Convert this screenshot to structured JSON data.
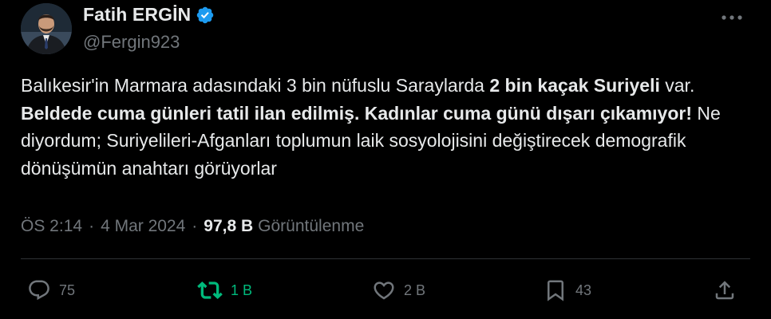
{
  "author": {
    "display_name": "Fatih ERGİN",
    "handle": "@Fergin923"
  },
  "tweet": {
    "segments": [
      {
        "text": "Balıkesir'in Marmara adasındaki 3 bin nüfuslu Saraylarda ",
        "bold": false
      },
      {
        "text": "2 bin kaçak Suriyeli",
        "bold": true
      },
      {
        "text": " var. ",
        "bold": false
      },
      {
        "text": "Beldede cuma günleri tatil ilan edilmiş. Kadınlar cuma günü dışarı çıkamıyor!",
        "bold": true
      },
      {
        "text": " Ne diyordum; Suriyelileri-Afganları toplumun laik sosyolojisini değiştirecek demografik dönüşümün anahtarı görüyorlar",
        "bold": false
      }
    ]
  },
  "meta": {
    "time": "ÖS 2:14",
    "separator": "·",
    "date": "4 Mar 2024",
    "views_count": "97,8 B",
    "views_label": "Görüntülenme"
  },
  "actions": {
    "replies": "75",
    "reposts": "1 B",
    "likes": "2 B",
    "bookmarks": "43"
  },
  "colors": {
    "background": "#000000",
    "text": "#e7e9ea",
    "muted": "#71767b",
    "verified": "#1d9bf0",
    "repost_active": "#00ba7c",
    "divider": "#2f3336"
  },
  "icons": {
    "verified": "verified-badge-icon",
    "more": "more-dots-icon",
    "reply": "reply-icon",
    "repost": "repost-icon",
    "like": "heart-icon",
    "bookmark": "bookmark-icon",
    "share": "share-icon"
  }
}
